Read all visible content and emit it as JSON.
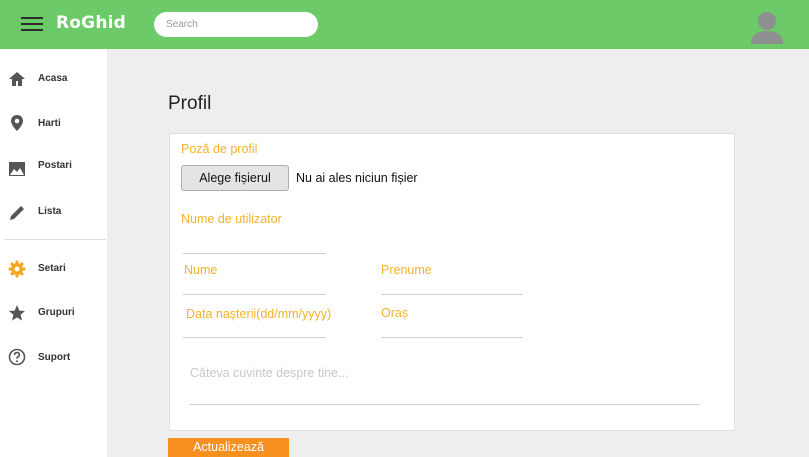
{
  "header": {
    "brand": "RoGhid",
    "search_placeholder": "Search",
    "bar_color": "#6ccb68"
  },
  "sidebar": {
    "items": [
      {
        "label": "Acasa",
        "icon": "home-icon"
      },
      {
        "label": "Harti",
        "icon": "map-pin-icon"
      },
      {
        "label": "Postari",
        "icon": "image-icon"
      },
      {
        "label": "Lista",
        "icon": "pencil-icon"
      },
      {
        "label": "Setari",
        "icon": "gear-icon",
        "icon_color": "#f5a623"
      },
      {
        "label": "Grupuri",
        "icon": "star-icon"
      },
      {
        "label": "Suport",
        "icon": "help-circle-icon"
      }
    ]
  },
  "main": {
    "title": "Profil",
    "profile_picture_label": "Poză de profil",
    "file_button_label": "Alege fișierul",
    "file_status": "Nu ai ales niciun fișier",
    "username_label": "Nume de utilizator",
    "lastname_label": "Nume",
    "firstname_label": "Prenume",
    "birthdate_label": "Data nașterii(dd/mm/yyyy)",
    "city_label": "Oraș",
    "about_placeholder": "Câteva cuvinte despre tine...",
    "submit_label": "Actualizează",
    "label_color": "#f5b22b",
    "submit_color": "#f7901e"
  }
}
